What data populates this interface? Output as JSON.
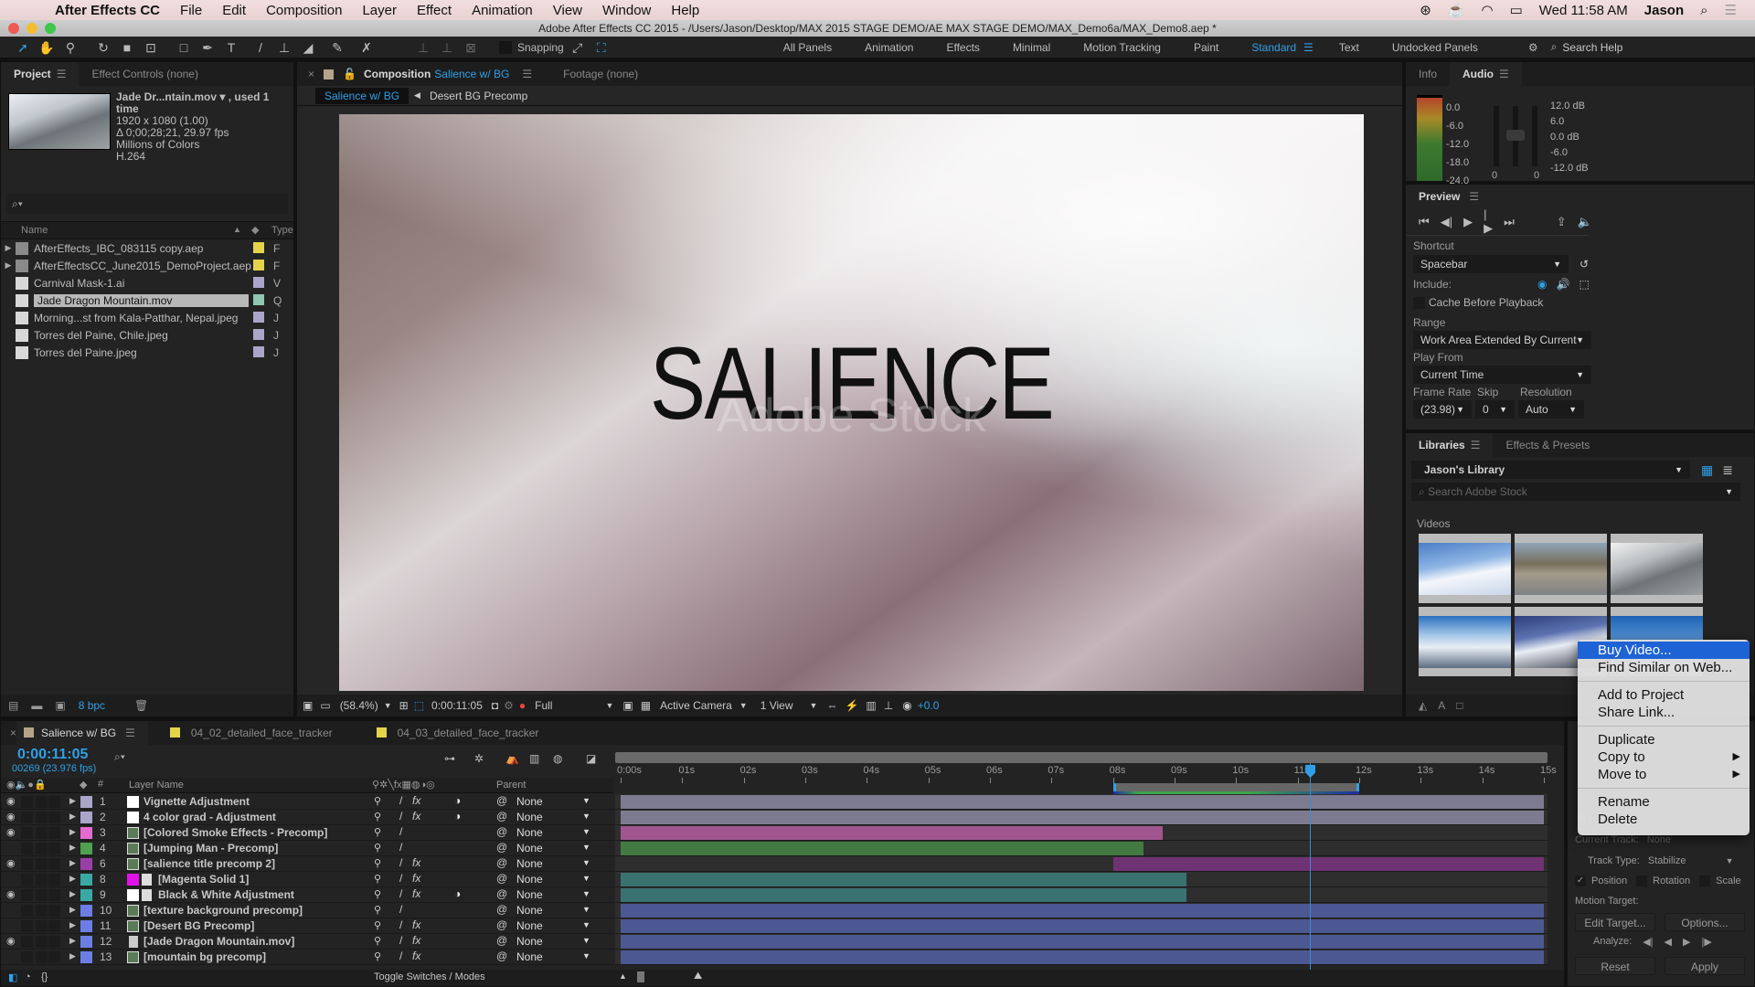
{
  "menubar": {
    "app": "After Effects CC",
    "items": [
      "File",
      "Edit",
      "Composition",
      "Layer",
      "Effect",
      "Animation",
      "View",
      "Window",
      "Help"
    ],
    "clock": "Wed 11:58 AM",
    "user": "Jason"
  },
  "window": {
    "title": "Adobe After Effects CC 2015 - /Users/Jason/Desktop/MAX 2015 STAGE DEMO/AE MAX STAGE DEMO/MAX_Demo6a/MAX_Demo8.aep *"
  },
  "toolbar": {
    "snapping": "Snapping",
    "workspaces": [
      "All Panels",
      "Animation",
      "Effects",
      "Minimal",
      "Motion Tracking",
      "Paint",
      "Standard",
      "Text",
      "Undocked Panels"
    ],
    "active_workspace": "Standard",
    "search_help": "Search Help"
  },
  "project": {
    "tabs": [
      "Project",
      "Effect Controls (none)"
    ],
    "preview_info": {
      "name": "Jade Dr...ntain.mov ▾ , used 1 time",
      "dims": "1920 x 1080 (1.00)",
      "duration": "Δ 0;00;28;21, 29.97 fps",
      "colors": "Millions of Colors",
      "codec": "H.264"
    },
    "columns": {
      "name": "Name",
      "type": "Type"
    },
    "items": [
      {
        "name": "AfterEffects_IBC_083115 copy.aep",
        "kind": "folder",
        "label": "#e3d44a",
        "type": "F"
      },
      {
        "name": "AfterEffectsCC_June2015_DemoProject.aep",
        "kind": "folder",
        "label": "#e3d44a",
        "type": "F"
      },
      {
        "name": "Carnival Mask-1.ai",
        "kind": "file",
        "label": "#a9a6c9",
        "type": "V"
      },
      {
        "name": "Jade Dragon Mountain.mov",
        "kind": "movie",
        "label": "#8fc7b1",
        "type": "Q",
        "selected": true
      },
      {
        "name": "Morning...st from Kala-Patthar, Nepal.jpeg",
        "kind": "file",
        "label": "#a9a6c9",
        "type": "J"
      },
      {
        "name": "Torres del Paine, Chile.jpeg",
        "kind": "file",
        "label": "#a9a6c9",
        "type": "J"
      },
      {
        "name": "Torres del Paine.jpeg",
        "kind": "file",
        "label": "#a9a6c9",
        "type": "J"
      }
    ],
    "bpc": "8 bpc"
  },
  "composition": {
    "tab_label": "Composition",
    "comp_name": "Salience w/ BG",
    "footage_tab": "Footage (none)",
    "breadcrumbs": [
      "Salience w/ BG",
      "Desert BG Precomp"
    ],
    "viewer_title": "SALIENCE",
    "watermark": "Adobe Stock",
    "footer": {
      "zoom": "(58.4%)",
      "timecode": "0:00:11:05",
      "resolution": "Full",
      "camera": "Active Camera",
      "views": "1 View",
      "exposure": "+0.0"
    }
  },
  "audio": {
    "tabs": [
      "Info",
      "Audio"
    ],
    "meter_scale": [
      "0.0",
      "-6.0",
      "-12.0",
      "-18.0",
      "-24.0"
    ],
    "db_scale": [
      "12.0 dB",
      "6.0",
      "0.0 dB",
      "-6.0",
      "-12.0 dB"
    ],
    "channel_values": [
      "0",
      "0"
    ]
  },
  "preview": {
    "title": "Preview",
    "shortcut_label": "Shortcut",
    "shortcut": "Spacebar",
    "include_label": "Include:",
    "cache_label": "Cache Before Playback",
    "range_label": "Range",
    "range": "Work Area Extended By Current",
    "play_from_label": "Play From",
    "play_from": "Current Time",
    "frame_rate_label": "Frame Rate",
    "skip_label": "Skip",
    "resolution_label": "Resolution",
    "frame_rate": "(23.98)",
    "skip": "0",
    "resolution": "Auto"
  },
  "libraries": {
    "tabs": [
      "Libraries",
      "Effects & Presets"
    ],
    "library": "Jason's Library",
    "search_placeholder": "Search Adobe Stock",
    "section": "Videos"
  },
  "context_menu": {
    "groups": [
      [
        "Buy Video...",
        "Find Similar on Web..."
      ],
      [
        "Add to Project",
        "Share Link..."
      ],
      [
        "Duplicate",
        "Copy to",
        "Move to"
      ],
      [
        "Rename",
        "Delete"
      ]
    ],
    "highlighted": "Buy Video...",
    "submenus": [
      "Copy to",
      "Move to"
    ]
  },
  "tracker": {
    "current_track_label": "Current Track:",
    "current_track": "None",
    "track_type_label": "Track Type:",
    "track_type": "Stabilize",
    "position": "Position",
    "rotation": "Rotation",
    "scale": "Scale",
    "motion_target_label": "Motion Target:",
    "edit_target": "Edit Target...",
    "options": "Options...",
    "analyze_label": "Analyze:",
    "reset": "Reset",
    "apply": "Apply"
  },
  "timeline": {
    "tabs": [
      {
        "name": "Salience w/ BG",
        "color": "#b4a58a"
      },
      {
        "name": "04_02_detailed_face_tracker",
        "color": "#e3d44a"
      },
      {
        "name": "04_03_detailed_face_tracker",
        "color": "#e3d44a"
      }
    ],
    "timecode": "0:00:11:05",
    "frame_info": "00269 (23.976 fps)",
    "col_layer_name": "Layer Name",
    "col_parent": "Parent",
    "ruler": [
      "0:00s",
      "01s",
      "02s",
      "03s",
      "04s",
      "05s",
      "06s",
      "07s",
      "08s",
      "09s",
      "10s",
      "11s",
      "12s",
      "13s",
      "14s",
      "15s"
    ],
    "duration_s": 15,
    "current_time_s": 11.2,
    "work_area_s": [
      8.0,
      12.0
    ],
    "layers": [
      {
        "num": "1",
        "name": "Vignette Adjustment",
        "label": "#a9a6c9",
        "icon": "adjust",
        "fx": true,
        "adj": true,
        "eye": true,
        "bar_color": "#7d7b90",
        "start": 0,
        "end": 15
      },
      {
        "num": "2",
        "name": "4 color grad - Adjustment",
        "label": "#a9a6c9",
        "icon": "adjust",
        "fx": true,
        "adj": true,
        "eye": true,
        "bar_color": "#7d7b90",
        "start": 0,
        "end": 15
      },
      {
        "num": "3",
        "name": "[Colored Smoke Effects - Precomp]",
        "label": "#e36bd2",
        "icon": "comp",
        "fx": false,
        "adj": false,
        "eye": true,
        "bar_color": "#a0558f",
        "start": 0,
        "end": 8.8
      },
      {
        "num": "4",
        "name": "[Jumping Man - Precomp]",
        "label": "#4fa04f",
        "icon": "comp",
        "fx": false,
        "adj": false,
        "eye": false,
        "bar_color": "#437a42",
        "start": 0,
        "end": 8.5
      },
      {
        "num": "6",
        "name": "[salience title precomp 2]",
        "label": "#9b3fa8",
        "icon": "comp",
        "fx": true,
        "adj": false,
        "eye": true,
        "bar_color": "#6f3373",
        "start": 8.0,
        "end": 15
      },
      {
        "num": "8",
        "name": "[Magenta Solid 1]",
        "label": "#3aa9a6",
        "icon": "solid",
        "fx": true,
        "adj": false,
        "eye": false,
        "bar_color": "#3a7171",
        "start": 0,
        "end": 9.2
      },
      {
        "num": "9",
        "name": "Black & White Adjustment",
        "label": "#3aa9a6",
        "icon": "adjust",
        "fx": true,
        "adj": true,
        "eye": true,
        "bar_color": "#3a7171",
        "start": 0,
        "end": 9.2
      },
      {
        "num": "10",
        "name": "[texture background precomp]",
        "label": "#6c7ee3",
        "icon": "comp",
        "fx": false,
        "adj": false,
        "eye": false,
        "bar_color": "#4c5891",
        "start": 0,
        "end": 15
      },
      {
        "num": "11",
        "name": "[Desert BG Precomp]",
        "label": "#6c7ee3",
        "icon": "comp",
        "fx": true,
        "adj": false,
        "eye": false,
        "bar_color": "#4c5891",
        "start": 0,
        "end": 15
      },
      {
        "num": "12",
        "name": "[Jade Dragon Mountain.mov]",
        "label": "#6c7ee3",
        "icon": "movie",
        "fx": true,
        "adj": false,
        "eye": true,
        "bar_color": "#4c5891",
        "start": 0,
        "end": 15
      },
      {
        "num": "13",
        "name": "[mountain bg precomp]",
        "label": "#6c7ee3",
        "icon": "comp",
        "fx": true,
        "adj": false,
        "eye": false,
        "bar_color": "#4c5891",
        "start": 0,
        "end": 15
      }
    ],
    "parent_value": "None",
    "toggle_label": "Toggle Switches / Modes"
  },
  "colors": {
    "accent": "#2fa0e6",
    "menu_highlight": "#1e63d6",
    "playhead": "#2f8fdf"
  }
}
